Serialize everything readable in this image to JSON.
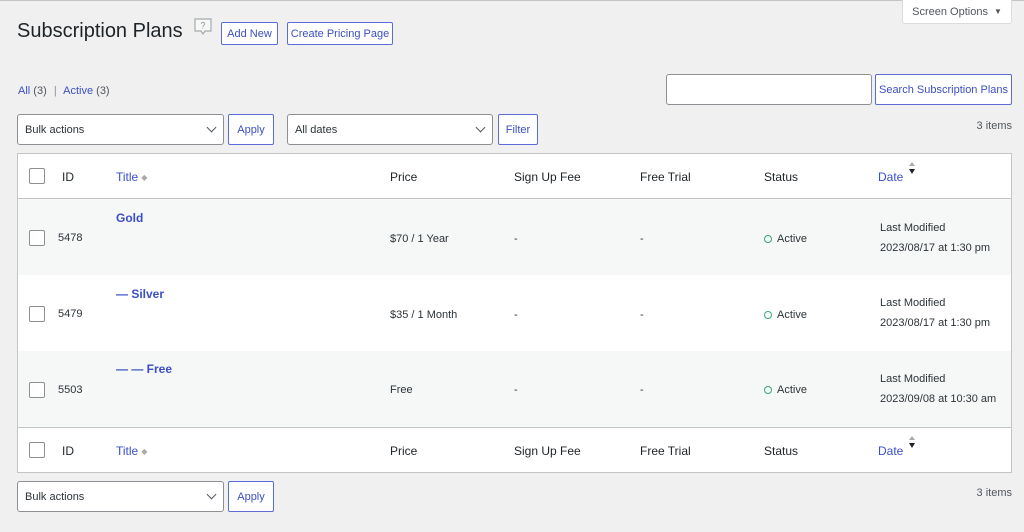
{
  "header": {
    "title": "Subscription Plans",
    "help_icon": "help-question-icon",
    "add_new_label": "Add New",
    "create_pricing_label": "Create Pricing Page",
    "screen_options_label": "Screen Options"
  },
  "filters": {
    "all_label": "All",
    "all_count": "(3)",
    "active_label": "Active",
    "active_count": "(3)",
    "separator": "|"
  },
  "search": {
    "value": "",
    "placeholder": "",
    "button_label": "Search Subscription Plans"
  },
  "toolbar_top": {
    "bulk_actions": "Bulk actions",
    "apply_label": "Apply",
    "dates": "All dates",
    "filter_label": "Filter",
    "items_count": "3 items"
  },
  "toolbar_bottom": {
    "bulk_actions": "Bulk actions",
    "apply_label": "Apply",
    "items_count": "3 items"
  },
  "table": {
    "columns": {
      "id": "ID",
      "title": "Title",
      "price": "Price",
      "signup_fee": "Sign Up Fee",
      "free_trial": "Free Trial",
      "status": "Status",
      "date": "Date"
    },
    "rows": [
      {
        "id": "5478",
        "title": "Gold",
        "price": "$70 / 1 Year",
        "signup_fee": "-",
        "free_trial": "-",
        "status": "Active",
        "date_label": "Last Modified",
        "date": "2023/08/17 at 1:30 pm"
      },
      {
        "id": "5479",
        "title": "— Silver",
        "price": "$35 / 1 Month",
        "signup_fee": "-",
        "free_trial": "-",
        "status": "Active",
        "date_label": "Last Modified",
        "date": "2023/08/17 at 1:30 pm"
      },
      {
        "id": "5503",
        "title": "— — Free",
        "price": "Free",
        "signup_fee": "-",
        "free_trial": "-",
        "status": "Active",
        "date_label": "Last Modified",
        "date": "2023/09/08 at 10:30 am"
      }
    ]
  },
  "colors": {
    "link": "#3a4fc5",
    "status_active": "#3aa57a",
    "background": "#f0f0f1"
  }
}
